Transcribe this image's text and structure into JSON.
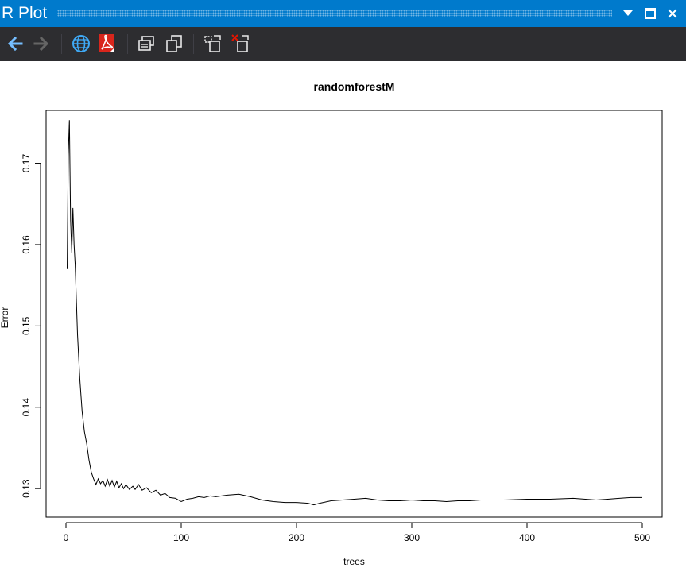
{
  "window": {
    "title": "R Plot"
  },
  "toolbar": {
    "buttons": [
      {
        "name": "back-button",
        "icon": "arrow-left-icon"
      },
      {
        "name": "forward-button",
        "icon": "arrow-right-icon"
      },
      {
        "name": "export-image-button",
        "icon": "globe-icon"
      },
      {
        "name": "export-pdf-button",
        "icon": "pdf-icon"
      },
      {
        "name": "copy-bitmap-button",
        "icon": "copy-bitmap-icon"
      },
      {
        "name": "copy-metafile-button",
        "icon": "copy-metafile-icon"
      },
      {
        "name": "move-plot-button",
        "icon": "move-plot-icon"
      },
      {
        "name": "remove-plot-button",
        "icon": "remove-plot-icon"
      }
    ]
  },
  "colors": {
    "titlebar": "#007acc",
    "toolbar": "#2d2d30",
    "arrow_active": "#75beff",
    "arrow_disabled": "#656565",
    "globe": "#3fa9f5",
    "pdf": "#d9261c"
  },
  "chart_data": {
    "type": "line",
    "title": "randomforestM",
    "xlabel": "trees",
    "ylabel": "Error",
    "xlim": [
      0,
      500
    ],
    "ylim": [
      0.1265,
      0.1765
    ],
    "xticks": [
      0,
      100,
      200,
      300,
      400,
      500
    ],
    "xtick_labels": [
      "0",
      "100",
      "200",
      "300",
      "400",
      "500"
    ],
    "yticks": [
      0.13,
      0.14,
      0.15,
      0.16,
      0.17
    ],
    "ytick_labels": [
      "0.13",
      "0.14",
      "0.15",
      "0.16",
      "0.17"
    ],
    "grid": false,
    "legend": "none",
    "series": [
      {
        "color": "#000000",
        "x": [
          1,
          2,
          3,
          4,
          5,
          6,
          7,
          8,
          10,
          12,
          14,
          16,
          18,
          20,
          22,
          24,
          26,
          28,
          30,
          32,
          34,
          36,
          38,
          40,
          42,
          44,
          46,
          48,
          50,
          52,
          55,
          58,
          60,
          63,
          66,
          70,
          74,
          78,
          82,
          86,
          90,
          95,
          100,
          105,
          110,
          115,
          120,
          125,
          130,
          140,
          150,
          160,
          170,
          180,
          190,
          200,
          210,
          215,
          220,
          230,
          240,
          250,
          260,
          270,
          280,
          290,
          300,
          310,
          320,
          330,
          340,
          350,
          360,
          380,
          400,
          420,
          440,
          460,
          470,
          480,
          490,
          500
        ],
        "values": [
          0.157,
          0.171,
          0.1753,
          0.163,
          0.159,
          0.1645,
          0.16,
          0.1575,
          0.149,
          0.1435,
          0.1395,
          0.137,
          0.1355,
          0.1335,
          0.132,
          0.1312,
          0.1305,
          0.1312,
          0.1306,
          0.131,
          0.1303,
          0.1311,
          0.1303,
          0.131,
          0.1302,
          0.1309,
          0.1301,
          0.1306,
          0.13,
          0.1305,
          0.1299,
          0.1303,
          0.1299,
          0.1305,
          0.1298,
          0.1301,
          0.1295,
          0.1298,
          0.1292,
          0.1294,
          0.1289,
          0.1288,
          0.1284,
          0.1287,
          0.1288,
          0.129,
          0.1289,
          0.1291,
          0.129,
          0.1292,
          0.1293,
          0.129,
          0.1286,
          0.1284,
          0.1283,
          0.1283,
          0.1282,
          0.128,
          0.1282,
          0.1285,
          0.1286,
          0.1287,
          0.1288,
          0.1286,
          0.1285,
          0.1285,
          0.1286,
          0.1285,
          0.1285,
          0.1284,
          0.1285,
          0.1285,
          0.1286,
          0.1286,
          0.1287,
          0.1287,
          0.1288,
          0.1286,
          0.1287,
          0.1288,
          0.1289,
          0.1289
        ]
      }
    ]
  }
}
